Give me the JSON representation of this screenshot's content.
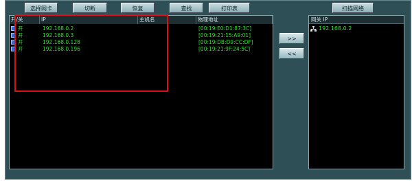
{
  "toolbar": {
    "select_adapter": "选择网卡",
    "cut": "切断",
    "restore": "恢复",
    "find": "查找",
    "print_table": "打印表",
    "scan_network": "扫描网络"
  },
  "host_table": {
    "columns": [
      "开/关",
      "IP",
      "主机名",
      "物理地址"
    ],
    "rows": [
      {
        "switch": "开",
        "ip": "192.168.0.2",
        "host": "",
        "mac": "[00:19:E0:D1:87:3C]"
      },
      {
        "switch": "开",
        "ip": "192.168.0.3",
        "host": "",
        "mac": "[00:19:21:15:A9:01]"
      },
      {
        "switch": "开",
        "ip": "192.168.0.128",
        "host": "",
        "mac": "[00:19:DB:D9:CC:DF]"
      },
      {
        "switch": "开",
        "ip": "192.168.0.196",
        "host": "",
        "mac": "[00:19:21:9F:24:5C]"
      }
    ]
  },
  "transfer": {
    "add_label": ">>",
    "remove_label": "<<"
  },
  "gateway": {
    "header": "网关 IP",
    "items": [
      {
        "ip": "192.168.0.2"
      }
    ]
  },
  "colors": {
    "panel_bg": "#000000",
    "text_green": "#33dd33",
    "frame": "#2f4f56",
    "highlight": "#dd1111"
  },
  "icons": {
    "switch_checkbox": "checkbox-icon",
    "gateway_icon": "network-icon"
  }
}
